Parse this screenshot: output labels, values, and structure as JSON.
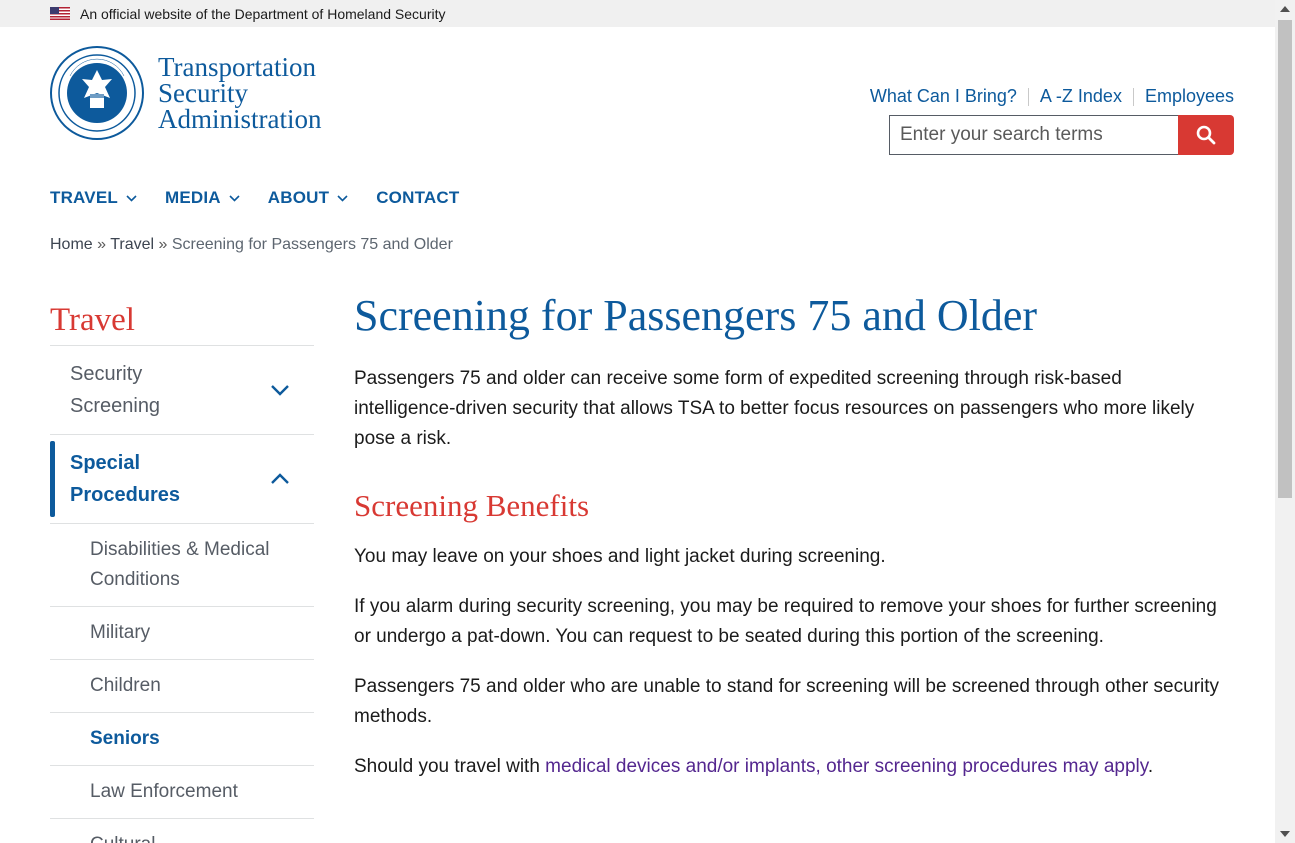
{
  "banner": {
    "flag_icon": "us-flag-icon",
    "text": "An official website of the Department of Homeland Security"
  },
  "logo": {
    "seal_icon": "dhs-seal-icon",
    "line1": "Transportation",
    "line2": "Security",
    "line3": "Administration"
  },
  "utility_links": [
    {
      "label": "What Can I Bring?"
    },
    {
      "label": "A -Z Index"
    },
    {
      "label": "Employees"
    }
  ],
  "search": {
    "placeholder": "Enter your search terms",
    "value": "",
    "button_icon": "search-icon"
  },
  "main_nav": [
    {
      "label": "TRAVEL",
      "has_dropdown": true
    },
    {
      "label": "MEDIA",
      "has_dropdown": true
    },
    {
      "label": "ABOUT",
      "has_dropdown": true
    },
    {
      "label": "CONTACT",
      "has_dropdown": false
    }
  ],
  "breadcrumb": {
    "home": "Home",
    "sep1": " » ",
    "travel": "Travel",
    "sep2": " » ",
    "current": "Screening for Passengers 75 and Older"
  },
  "sidenav": {
    "title": "Travel",
    "items": [
      {
        "label": "Security Screening",
        "state": "collapsed"
      },
      {
        "label": "Special Procedures",
        "state": "expanded",
        "active": true
      }
    ],
    "sub_items": [
      {
        "label": "Disabilities & Medical Conditions"
      },
      {
        "label": "Military"
      },
      {
        "label": "Children"
      },
      {
        "label": "Seniors",
        "active": true
      },
      {
        "label": "Law Enforcement"
      },
      {
        "label": "Cultural"
      }
    ]
  },
  "content": {
    "title": "Screening for Passengers 75 and Older",
    "intro": "Passengers 75 and older can receive some form of expedited screening through risk-based intelligence-driven security that allows TSA to better focus resources on passengers who more likely pose a risk.",
    "section_title": "Screening Benefits",
    "p1": "You may leave on your shoes and light jacket during screening.",
    "p2": "If you alarm during security screening, you may be required to remove your shoes for further screening or undergo a pat-down. You can request to be seated during this portion of the screening.",
    "p3": "Passengers 75 and older who are unable to stand for screening will be screened through other security methods.",
    "p4_prefix": "Should you travel with ",
    "p4_link": "medical devices and/or implants, other screening procedures may apply",
    "p4_suffix": "."
  },
  "colors": {
    "brand_blue": "#0d5a9c",
    "accent_red": "#d83933",
    "link_visited": "#54278f"
  }
}
